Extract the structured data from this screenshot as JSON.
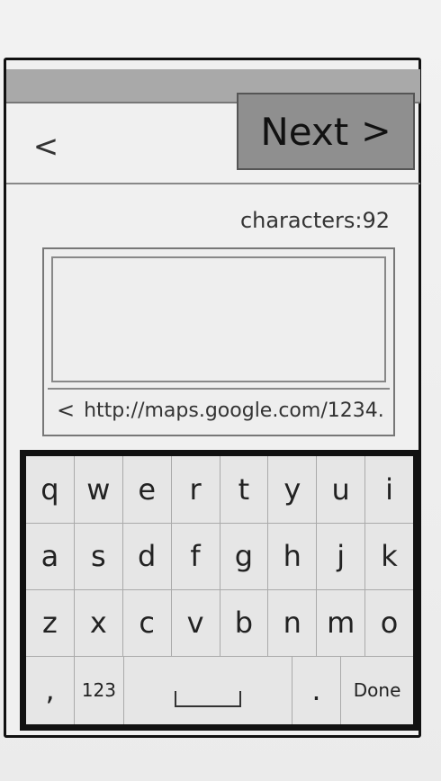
{
  "header": {
    "back_label": "<",
    "next_label": "Next",
    "next_chevron": ">"
  },
  "compose": {
    "char_count_label": "characters:",
    "char_count_value": "92",
    "placeholder": "",
    "url_prefix": "<",
    "url_text": "http://maps.google.com/1234."
  },
  "keyboard": {
    "row1": [
      "q",
      "w",
      "e",
      "r",
      "t",
      "y",
      "u",
      "i"
    ],
    "row2": [
      "a",
      "s",
      "d",
      "f",
      "g",
      "h",
      "j",
      "k"
    ],
    "row3": [
      "z",
      "x",
      "c",
      "v",
      "b",
      "n",
      "m",
      "o"
    ],
    "row4": {
      "comma": ",",
      "numbers": "123",
      "period": ".",
      "done": "Done"
    }
  }
}
